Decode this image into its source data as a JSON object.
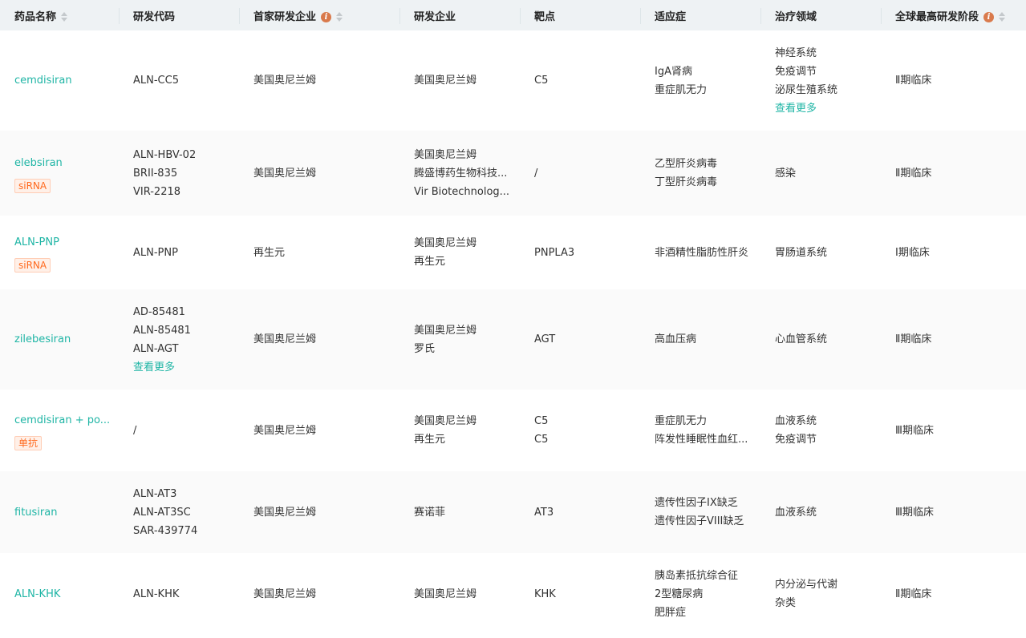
{
  "headers": [
    "药品名称",
    "研发代码",
    "首家研发企业",
    "研发企业",
    "靶点",
    "适应症",
    "治疗领域",
    "全球最高研发阶段"
  ],
  "more_label": "查看更多",
  "rows": [
    {
      "name": "cemdisiran",
      "tag": null,
      "codes": [
        "ALN-CC5"
      ],
      "codes_more": false,
      "first": "美国奥尼兰姆",
      "companies": [
        "美国奥尼兰姆"
      ],
      "targets": [
        "C5"
      ],
      "indications": [
        "IgA肾病",
        "重症肌无力"
      ],
      "areas": [
        "神经系统",
        "免疫调节",
        "泌尿生殖系统"
      ],
      "areas_more": true,
      "stage": "Ⅱ期临床"
    },
    {
      "name": "elebsiran",
      "tag": "siRNA",
      "codes": [
        "ALN-HBV-02",
        "BRII-835",
        "VIR-2218"
      ],
      "codes_more": false,
      "first": "美国奥尼兰姆",
      "companies": [
        "美国奥尼兰姆",
        "腾盛博药生物科技...",
        "Vir Biotechnolog..."
      ],
      "targets": [
        "/"
      ],
      "indications": [
        "乙型肝炎病毒",
        "丁型肝炎病毒"
      ],
      "areas": [
        "感染"
      ],
      "areas_more": false,
      "stage": "Ⅱ期临床"
    },
    {
      "name": "ALN-PNP",
      "tag": "siRNA",
      "codes": [
        "ALN-PNP"
      ],
      "codes_more": false,
      "first": "再生元",
      "companies": [
        "美国奥尼兰姆",
        "再生元"
      ],
      "targets": [
        "PNPLA3"
      ],
      "indications": [
        "非酒精性脂肪性肝炎"
      ],
      "areas": [
        "胃肠道系统"
      ],
      "areas_more": false,
      "stage": "Ⅰ期临床"
    },
    {
      "name": "zilebesiran",
      "tag": null,
      "codes": [
        "AD-85481",
        "ALN-85481",
        "ALN-AGT"
      ],
      "codes_more": true,
      "first": "美国奥尼兰姆",
      "companies": [
        "美国奥尼兰姆",
        "罗氏"
      ],
      "targets": [
        "AGT"
      ],
      "indications": [
        "高血压病"
      ],
      "areas": [
        "心血管系统"
      ],
      "areas_more": false,
      "stage": "Ⅱ期临床"
    },
    {
      "name": "cemdisiran + po...",
      "tag": "单抗",
      "codes": [
        "/"
      ],
      "codes_more": false,
      "first": "美国奥尼兰姆",
      "companies": [
        "美国奥尼兰姆",
        "再生元"
      ],
      "targets": [
        "C5",
        "C5"
      ],
      "indications": [
        "重症肌无力",
        "阵发性睡眠性血红..."
      ],
      "areas": [
        "血液系统",
        "免疫调节"
      ],
      "areas_more": false,
      "stage": "Ⅲ期临床"
    },
    {
      "name": "fitusiran",
      "tag": null,
      "codes": [
        "ALN-AT3",
        "ALN-AT3SC",
        "SAR-439774"
      ],
      "codes_more": false,
      "first": "美国奥尼兰姆",
      "companies": [
        "赛诺菲"
      ],
      "targets": [
        "AT3"
      ],
      "indications": [
        "遗传性因子IX缺乏",
        "遗传性因子VIII缺乏"
      ],
      "areas": [
        "血液系统"
      ],
      "areas_more": false,
      "stage": "Ⅲ期临床"
    },
    {
      "name": "ALN-KHK",
      "tag": null,
      "codes": [
        "ALN-KHK"
      ],
      "codes_more": false,
      "first": "美国奥尼兰姆",
      "companies": [
        "美国奥尼兰姆"
      ],
      "targets": [
        "KHK"
      ],
      "indications": [
        "胰岛素抵抗综合征",
        "2型糖尿病",
        "肥胖症"
      ],
      "areas": [
        "内分泌与代谢",
        "杂类"
      ],
      "areas_more": false,
      "stage": "Ⅱ期临床"
    }
  ]
}
